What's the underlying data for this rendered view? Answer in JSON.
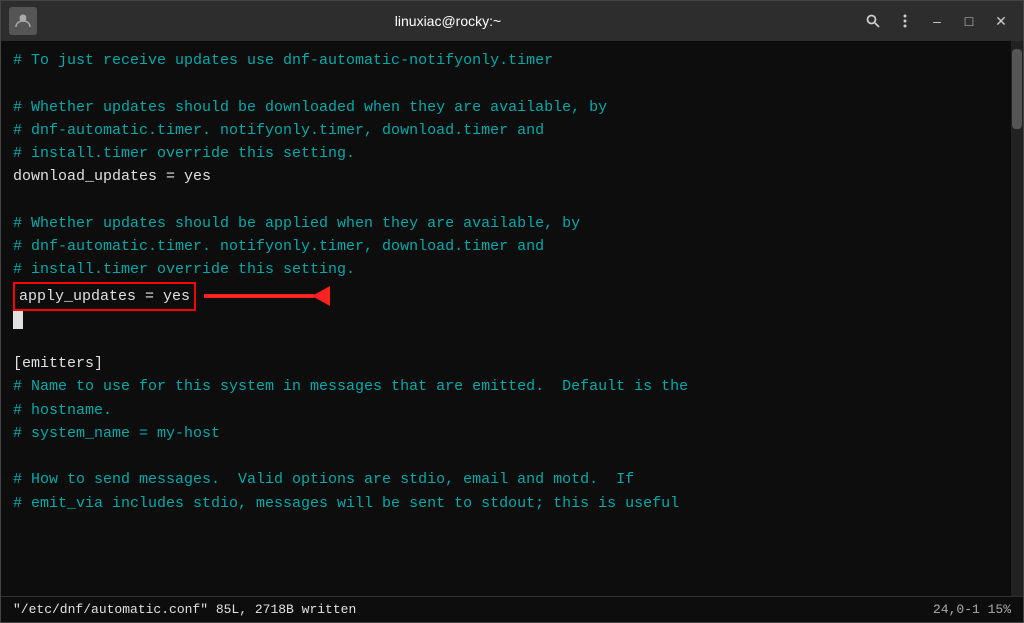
{
  "titlebar": {
    "title": "linuxiac@rocky:~",
    "avatar_icon": "👤",
    "search_icon": "🔍",
    "menu_icon": "⋮",
    "minimize_label": "–",
    "maximize_label": "□",
    "close_label": "✕"
  },
  "terminal": {
    "lines": [
      {
        "type": "comment",
        "text": "# To just receive updates use dnf-automatic-notifyonly.timer"
      },
      {
        "type": "blank",
        "text": ""
      },
      {
        "type": "comment",
        "text": "# Whether updates should be downloaded when they are available, by"
      },
      {
        "type": "comment",
        "text": "# dnf-automatic.timer. notifyonly.timer, download.timer and"
      },
      {
        "type": "comment",
        "text": "# install.timer override this setting."
      },
      {
        "type": "value",
        "text": "download_updates = yes"
      },
      {
        "type": "blank",
        "text": ""
      },
      {
        "type": "comment",
        "text": "# Whether updates should be applied when they are available, by"
      },
      {
        "type": "comment",
        "text": "# dnf-automatic.timer. notifyonly.timer, download.timer and"
      },
      {
        "type": "comment",
        "text": "# install.timer override this setting."
      },
      {
        "type": "highlighted",
        "text": "apply_updates = yes"
      },
      {
        "type": "cursor",
        "text": ""
      },
      {
        "type": "blank",
        "text": ""
      },
      {
        "type": "value",
        "text": "[emitters]"
      },
      {
        "type": "comment",
        "text": "# Name to use for this system in messages that are emitted.  Default is the"
      },
      {
        "type": "comment",
        "text": "# hostname."
      },
      {
        "type": "comment",
        "text": "# system_name = my-host"
      },
      {
        "type": "blank",
        "text": ""
      },
      {
        "type": "comment",
        "text": "# How to send messages.  Valid options are stdio, email and motd.  If"
      },
      {
        "type": "comment",
        "text": "# emit_via includes stdio, messages will be sent to stdout; this is useful"
      }
    ]
  },
  "statusbar": {
    "left": "\"/etc/dnf/automatic.conf\" 85L, 2718B written",
    "right": "24,0-1          15%"
  }
}
